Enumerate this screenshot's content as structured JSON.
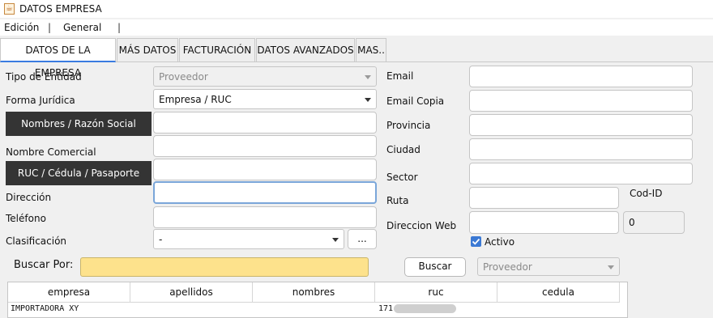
{
  "window": {
    "title": "DATOS EMPRESA"
  },
  "menu": {
    "items": [
      "Edición",
      "General"
    ],
    "separators": [
      "|",
      "|",
      "|"
    ]
  },
  "tabs": [
    {
      "label": "DATOS DE LA EMPRESA",
      "active": true
    },
    {
      "label": "MÁS DATOS"
    },
    {
      "label": "FACTURACIÓN"
    },
    {
      "label": "DATOS AVANZADOS"
    },
    {
      "label": "MAS.."
    }
  ],
  "form": {
    "tipo_entidad": {
      "label": "Tipo de Entidad",
      "value": "Proveedor"
    },
    "forma_juridica": {
      "label": "Forma Jurídica",
      "value": "Empresa / RUC"
    },
    "razon_social": {
      "button_label": "Nombres / Razón Social",
      "value": ""
    },
    "nombre_comercial": {
      "label": "Nombre Comercial",
      "value": ""
    },
    "ruc": {
      "button_label": "RUC / Cédula / Pasaporte",
      "value": ""
    },
    "direccion": {
      "label": "Dirección",
      "value": ""
    },
    "telefono": {
      "label": "Teléfono",
      "value": ""
    },
    "clasificacion": {
      "label": "Clasificación",
      "value": "-",
      "button_label": "..."
    },
    "email": {
      "label": "Email",
      "value": ""
    },
    "email_copia": {
      "label": "Email Copia",
      "value": ""
    },
    "provincia": {
      "label": "Provincia",
      "value": ""
    },
    "ciudad": {
      "label": "Ciudad",
      "value": ""
    },
    "sector": {
      "label": "Sector",
      "value": ""
    },
    "ruta": {
      "label": "Ruta",
      "value": ""
    },
    "cod_id": {
      "label": "Cod-ID"
    },
    "direccion_web": {
      "label": "Direccion Web",
      "value": ""
    },
    "id_value": "0",
    "activo": {
      "label": "Activo",
      "checked": true
    }
  },
  "search": {
    "label": "Buscar Por:",
    "value": "",
    "button_label": "Buscar",
    "type_value": "Proveedor"
  },
  "table": {
    "columns": [
      "empresa",
      "apellidos",
      "nombres",
      "ruc",
      "cedula"
    ],
    "rows": [
      {
        "empresa": "IMPORTADORA XY",
        "apellidos": "",
        "nombres": "",
        "ruc": "171",
        "cedula": ""
      }
    ]
  },
  "colors": {
    "accent": "#3a7be0",
    "dark_button": "#343434",
    "search_highlight": "#fde28c"
  }
}
